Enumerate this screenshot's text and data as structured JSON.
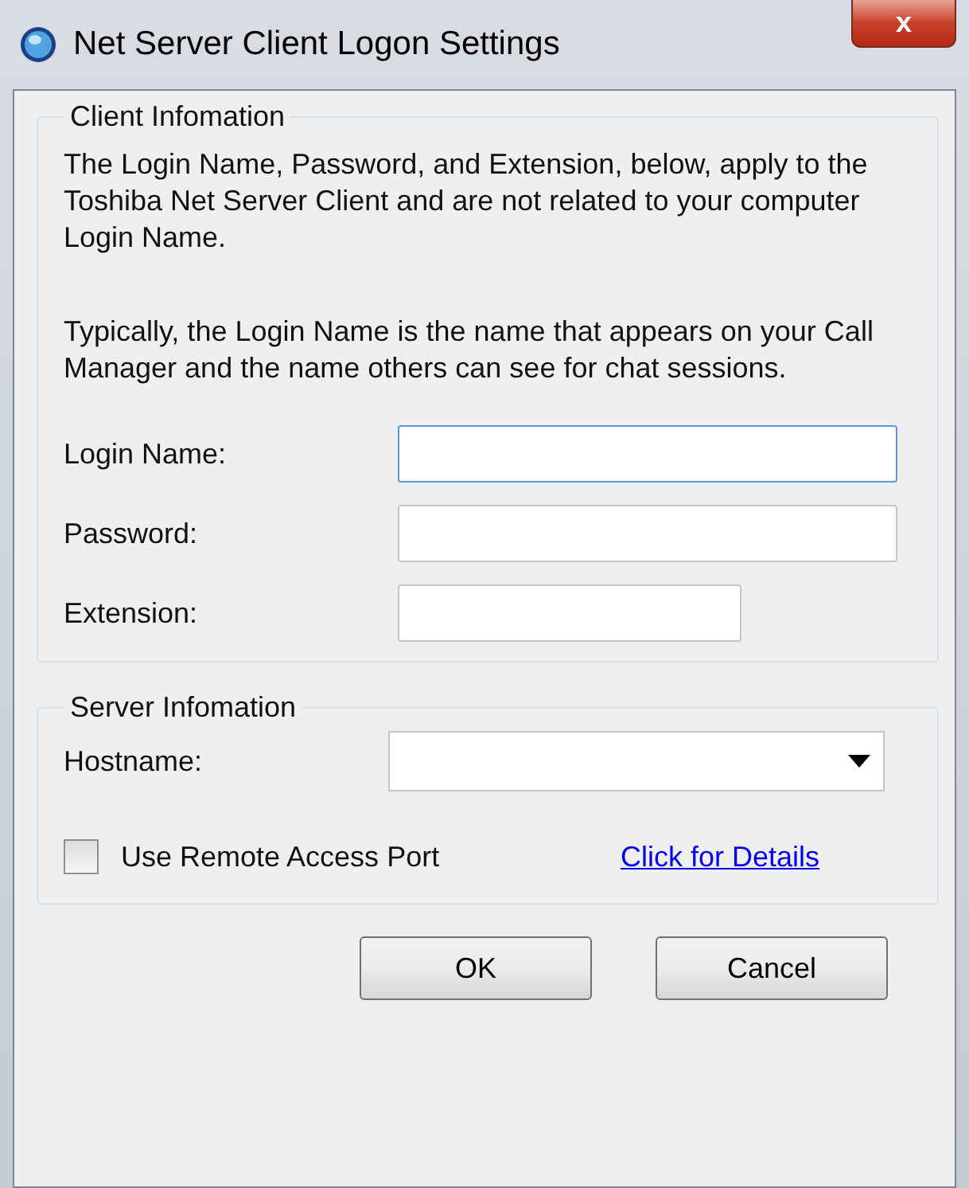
{
  "window": {
    "title": "Net Server Client Logon Settings",
    "close": "x"
  },
  "client_group": {
    "title": "Client Infomation",
    "paragraphs": [
      "The Login Name, Password, and Extension, below, apply to the Toshiba Net Server Client and are not related to your computer Login Name.",
      "Typically, the Login Name is the name that appears on your Call Manager and the name others can see for chat sessions."
    ],
    "fields": [
      {
        "label": "Login Name:",
        "focused": true,
        "kind": "wide"
      },
      {
        "label": "Password:",
        "focused": false,
        "kind": "wide"
      },
      {
        "label": "Extension:",
        "focused": false,
        "kind": "short"
      }
    ]
  },
  "server_group": {
    "title": "Server Infomation",
    "hostname_label": "Hostname:",
    "remote_port": {
      "label": "Use Remote Access Port",
      "checked": false
    },
    "details_link": "Click for Details"
  },
  "buttons": [
    "OK",
    "Cancel"
  ]
}
